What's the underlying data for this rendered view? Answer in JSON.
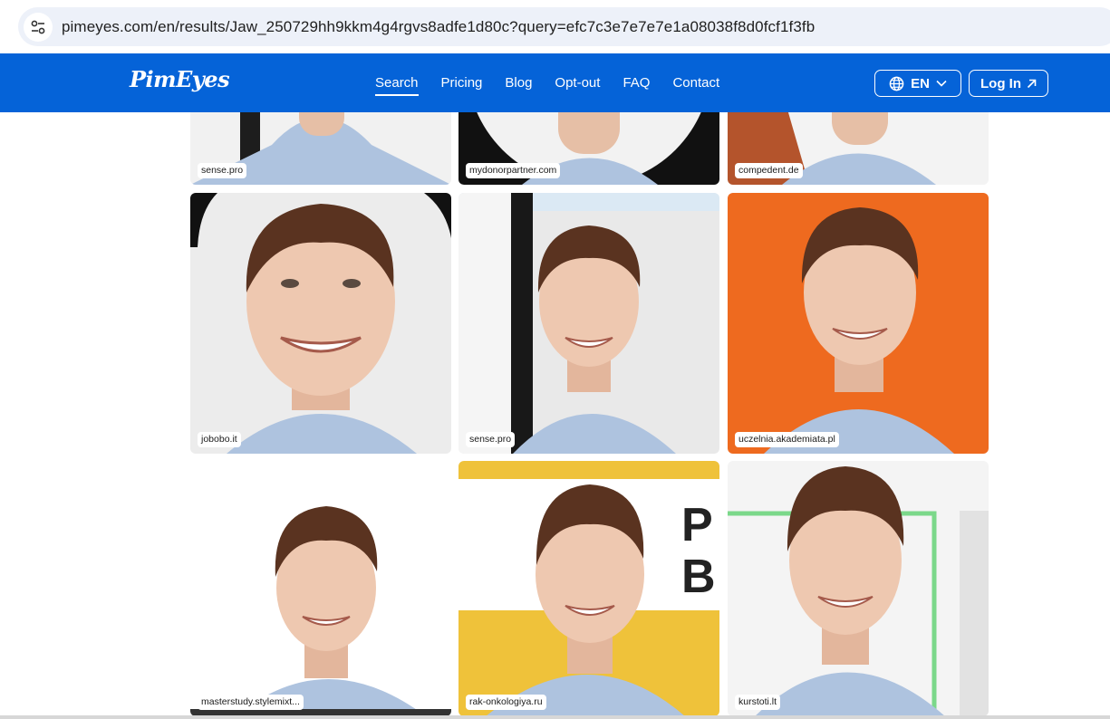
{
  "browser": {
    "url": "pimeyes.com/en/results/Jaw_250729hh9kkm4g4rgvs8adfe1d80c?query=efc7c3e7e7e7e1a08038f8d0fcf1f3fb",
    "site_info_icon": "tune-icon"
  },
  "header": {
    "logo": "PimEyes",
    "nav": [
      {
        "label": "Search",
        "active": true
      },
      {
        "label": "Pricing"
      },
      {
        "label": "Blog"
      },
      {
        "label": "Opt-out"
      },
      {
        "label": "FAQ"
      },
      {
        "label": "Contact"
      }
    ],
    "language": "EN",
    "login": "Log In",
    "colors": {
      "brand": "#0563d8",
      "text": "#ffffff"
    }
  },
  "results": [
    {
      "domain": "sense.pro",
      "bg": "#f1f1f1"
    },
    {
      "domain": "mydonorpartner.com",
      "bg": "#111111"
    },
    {
      "domain": "compedent.de",
      "bg": "#f3f3f3"
    },
    {
      "domain": "jobobo.it",
      "bg": "#ececec"
    },
    {
      "domain": "sense.pro",
      "bg": "#e9e9e9"
    },
    {
      "domain": "uczelnia.akademiata.pl",
      "bg": "#ee6a1f"
    },
    {
      "domain": "masterstudy.stylemixt...",
      "bg": "#ffffff"
    },
    {
      "domain": "rak-onkologiya.ru",
      "bg": "#efc23a"
    },
    {
      "domain": "kurstoti.lt",
      "bg": "#f4f4f4"
    }
  ]
}
